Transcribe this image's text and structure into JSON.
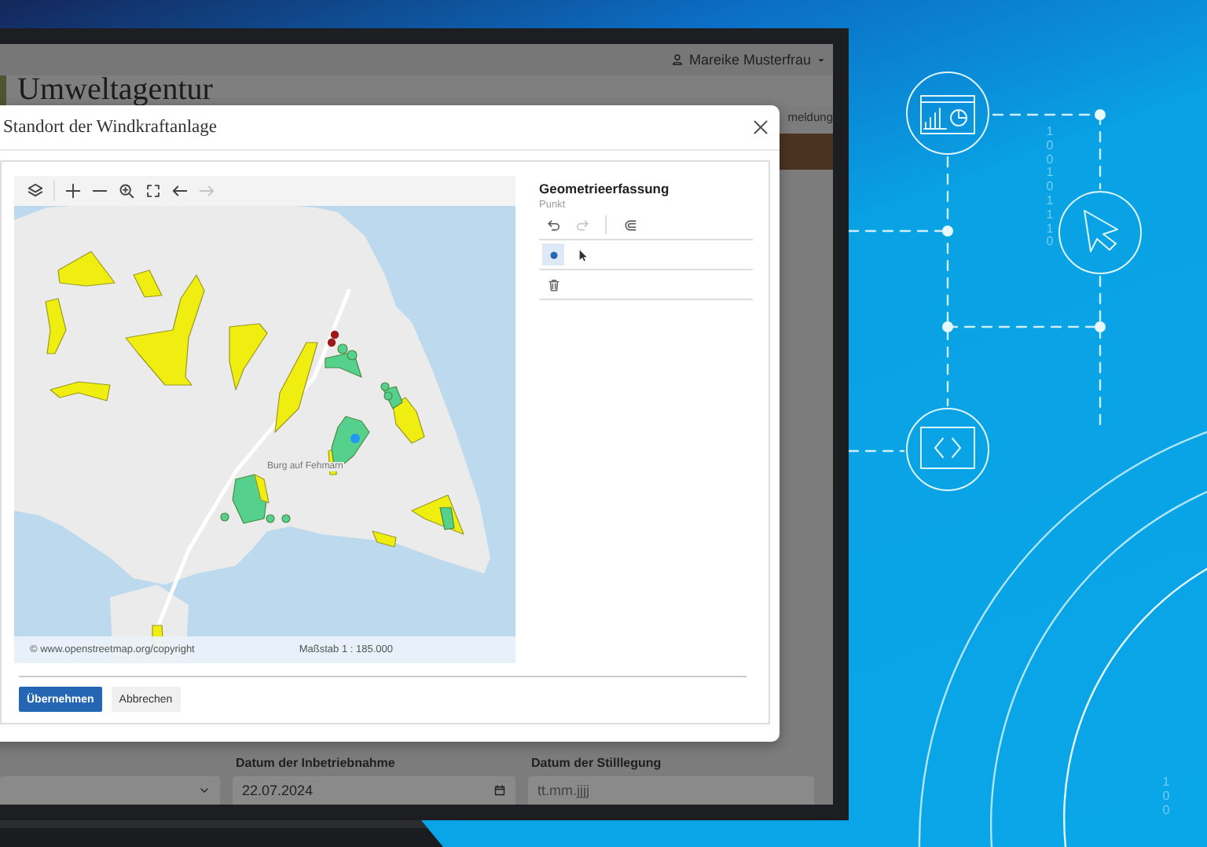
{
  "user_menu": {
    "name": "Mareike Musterfrau"
  },
  "app": {
    "title": "Umweltagentur",
    "nav_fragment": "meldung"
  },
  "dialog": {
    "title": "Standort der Windkraftanlage",
    "map": {
      "tools": [
        {
          "kind": "layers",
          "disabled": false
        },
        {
          "kind": "zoom_in",
          "disabled": false
        },
        {
          "kind": "zoom_out",
          "disabled": false
        },
        {
          "kind": "zoom_extent",
          "disabled": false
        },
        {
          "kind": "fullscreen",
          "disabled": false
        },
        {
          "kind": "back",
          "disabled": false
        },
        {
          "kind": "forward",
          "disabled": true
        }
      ],
      "place_label": "Burg auf Fehmarn",
      "attribution": "© www.openstreetmap.org/copyright",
      "scale": "Maßstab 1 : 185.000"
    },
    "geometry": {
      "title": "Geometrieerfassung",
      "subtitle": "Punkt",
      "tools": [
        {
          "kind": "undo",
          "disabled": false
        },
        {
          "kind": "redo",
          "disabled": true
        },
        {
          "kind": "snap",
          "disabled": false
        }
      ],
      "draw_tools": [
        {
          "kind": "point",
          "selected": true
        },
        {
          "kind": "select",
          "selected": false
        }
      ],
      "actions": [
        {
          "kind": "delete"
        }
      ]
    },
    "buttons": [
      {
        "label": "Übernehmen",
        "kind": "primary"
      },
      {
        "label": "Abbrechen",
        "kind": "secondary"
      }
    ]
  },
  "form": {
    "fields": [
      {
        "kind": "select"
      },
      {
        "kind": "date",
        "label": "Datum der Inbetriebnahme",
        "value": "22.07.2024"
      },
      {
        "kind": "date",
        "label": "Datum der Stilllegung",
        "placeholder": "tt.mm.jjjj"
      }
    ]
  },
  "decoration": {
    "binary_columns": [
      "100101110",
      "100"
    ]
  }
}
